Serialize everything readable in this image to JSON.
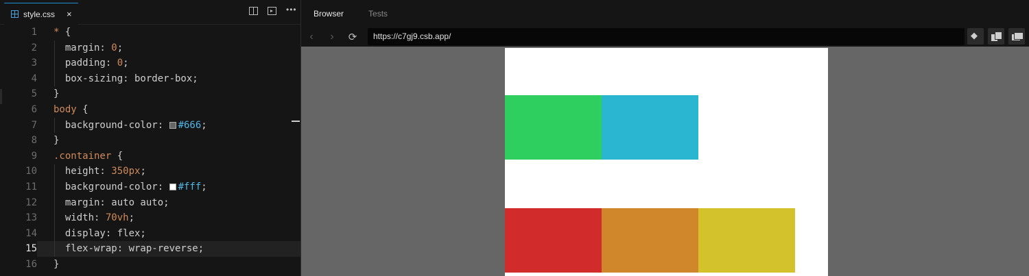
{
  "editor": {
    "tab": {
      "filename": "style.css",
      "close": "×"
    },
    "actions": [
      "split-editor",
      "open-preview",
      "more"
    ],
    "lines": [
      {
        "n": "1",
        "parts": [
          [
            "sel",
            "*"
          ],
          [
            "plain",
            " {"
          ]
        ]
      },
      {
        "n": "2",
        "parts": [
          [
            "plain",
            "  margin: "
          ],
          [
            "num",
            "0"
          ],
          [
            "plain",
            ";"
          ]
        ]
      },
      {
        "n": "3",
        "parts": [
          [
            "plain",
            "  padding: "
          ],
          [
            "num",
            "0"
          ],
          [
            "plain",
            ";"
          ]
        ]
      },
      {
        "n": "4",
        "parts": [
          [
            "plain",
            "  box-sizing: border-box;"
          ]
        ]
      },
      {
        "n": "5",
        "parts": [
          [
            "plain",
            "}"
          ]
        ]
      },
      {
        "n": "6",
        "parts": [
          [
            "sel",
            "body"
          ],
          [
            "plain",
            " {"
          ]
        ]
      },
      {
        "n": "7",
        "parts": [
          [
            "plain",
            "  background-color: "
          ],
          [
            "swatch",
            "#666666"
          ],
          [
            "hex",
            "#666"
          ],
          [
            "plain",
            ";"
          ]
        ]
      },
      {
        "n": "8",
        "parts": [
          [
            "plain",
            "}"
          ]
        ]
      },
      {
        "n": "9",
        "parts": [
          [
            "sel",
            ".container"
          ],
          [
            "plain",
            " {"
          ]
        ]
      },
      {
        "n": "10",
        "parts": [
          [
            "plain",
            "  height: "
          ],
          [
            "num",
            "350px"
          ],
          [
            "plain",
            ";"
          ]
        ]
      },
      {
        "n": "11",
        "parts": [
          [
            "plain",
            "  background-color: "
          ],
          [
            "swatch",
            "#ffffff"
          ],
          [
            "hex",
            "#fff"
          ],
          [
            "plain",
            ";"
          ]
        ]
      },
      {
        "n": "12",
        "parts": [
          [
            "plain",
            "  margin: auto auto;"
          ]
        ]
      },
      {
        "n": "13",
        "parts": [
          [
            "plain",
            "  width: "
          ],
          [
            "num",
            "70vh"
          ],
          [
            "plain",
            ";"
          ]
        ]
      },
      {
        "n": "14",
        "parts": [
          [
            "plain",
            "  display: flex;"
          ]
        ]
      },
      {
        "n": "15",
        "parts": [
          [
            "plain",
            "  flex-wrap: wrap-reverse;"
          ]
        ],
        "active": true
      },
      {
        "n": "16",
        "parts": [
          [
            "plain",
            "}"
          ]
        ]
      }
    ]
  },
  "browser": {
    "tabs": [
      {
        "label": "Browser",
        "active": true
      },
      {
        "label": "Tests",
        "active": false
      }
    ],
    "url": "https://c7gj9.csb.app/",
    "nav": {
      "back": "‹",
      "forward": "›",
      "reload": "⟳"
    },
    "boxes": [
      {
        "color": "#d12b2b",
        "row": "bottom",
        "index": 0
      },
      {
        "color": "#d0872c",
        "row": "bottom",
        "index": 1
      },
      {
        "color": "#d4c22c",
        "row": "bottom",
        "index": 2
      },
      {
        "color": "#2ecf5e",
        "row": "top",
        "index": 0
      },
      {
        "color": "#2ab6d1",
        "row": "top",
        "index": 1
      }
    ]
  }
}
